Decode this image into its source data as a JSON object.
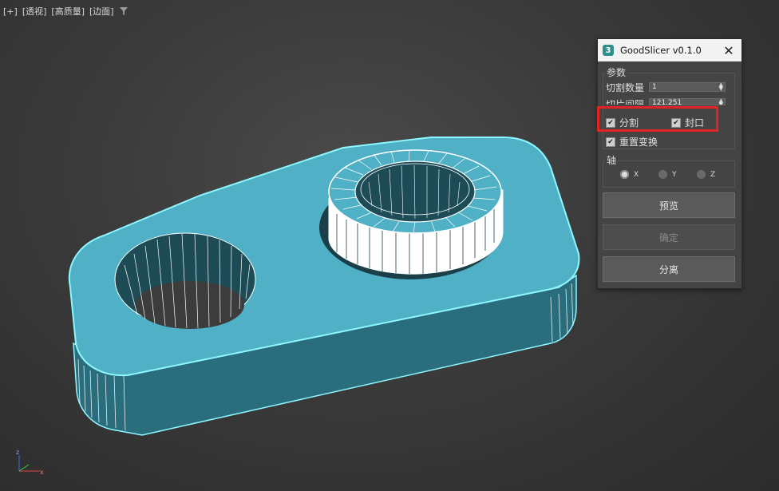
{
  "viewport": {
    "label_plus": "[+]",
    "label_view": "[透视]",
    "label_quality": "[高质量]",
    "label_shading": "[边面]",
    "filter_icon": "funnel-icon"
  },
  "panel": {
    "title": "GoodSlicer v0.1.0",
    "app_icon_text": "3",
    "close_glyph": "✕",
    "params_group": "参数",
    "cut_count_label": "切割数量",
    "cut_count_value": "1",
    "slice_spacing_label": "切片间隔",
    "slice_spacing_value": "121.251",
    "split_label": "分割",
    "split_checked": true,
    "cap_label": "封口",
    "cap_checked": true,
    "reset_label": "重置变换",
    "reset_checked": true,
    "axis_group": "轴",
    "axis_x": "X",
    "axis_y": "Y",
    "axis_z": "Z",
    "axis_selected": "X",
    "preview_button": "预览",
    "confirm_button": "确定",
    "detach_button": "分离"
  },
  "colors": {
    "object_top": "#4fb0c6",
    "object_side": "#2a6e7d",
    "selection_outline": "#8ff7ff",
    "highlight": "#e02323"
  }
}
